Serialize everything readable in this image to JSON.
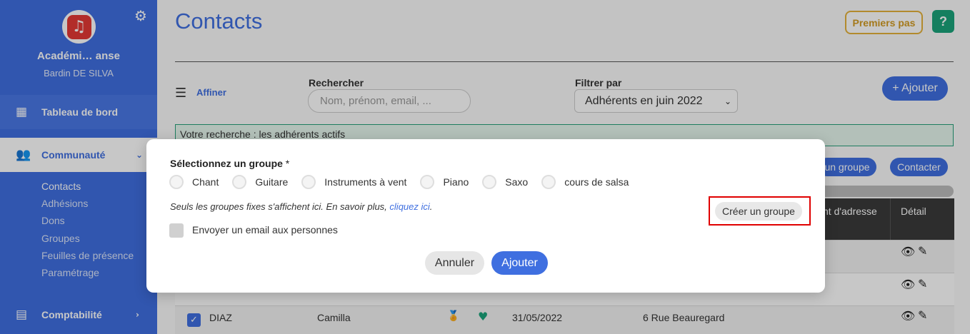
{
  "sidebar": {
    "org_name": "Académi… anse",
    "user_name": "Bardin DE SILVA",
    "gear_icon": "⚙",
    "logo_icon": "♫",
    "nav": {
      "dashboard": "Tableau de bord",
      "community": "Communauté",
      "accounting": "Comptabilité"
    },
    "subnav": [
      "Contacts",
      "Adhésions",
      "Dons",
      "Groupes",
      "Feuilles de présence",
      "Paramétrage"
    ]
  },
  "header": {
    "title": "Contacts",
    "premiers_pas": "Premiers pas",
    "help": "?"
  },
  "toolbar": {
    "affiner": "Affiner",
    "search_label": "Rechercher",
    "search_placeholder": "Nom, prénom, email, ...",
    "filter_label": "Filtrer par",
    "filter_value": "Adhérents en juin 2022",
    "add_button": "+ Ajouter"
  },
  "search_info": "Votre recherche : les adhérents actifs",
  "actions": {
    "group_button": "un groupe",
    "contact_button": "Contacter"
  },
  "table": {
    "headers": {
      "address": "nt d'adresse",
      "detail": "Détail"
    },
    "row3": {
      "name": "DIAZ",
      "firstname": "Camilla",
      "date": "31/05/2022",
      "address": "6 Rue Beauregard"
    }
  },
  "modal": {
    "title": "Sélectionnez un groupe",
    "required_mark": "*",
    "groups": [
      "Chant",
      "Guitare",
      "Instruments à vent",
      "Piano",
      "Saxo",
      "cours de salsa"
    ],
    "note": "Seuls les groupes fixes s'affichent ici. En savoir plus,",
    "note_link": "cliquez ici",
    "note_end": ".",
    "create_group": "Créer un groupe",
    "email_checkbox": "Envoyer un email aux personnes",
    "cancel": "Annuler",
    "confirm": "Ajouter"
  },
  "colors": {
    "primary": "#3f6fe0",
    "accent_gold": "#e5b13a",
    "help_green": "#1aa37a",
    "highlight_red": "#e00000"
  }
}
